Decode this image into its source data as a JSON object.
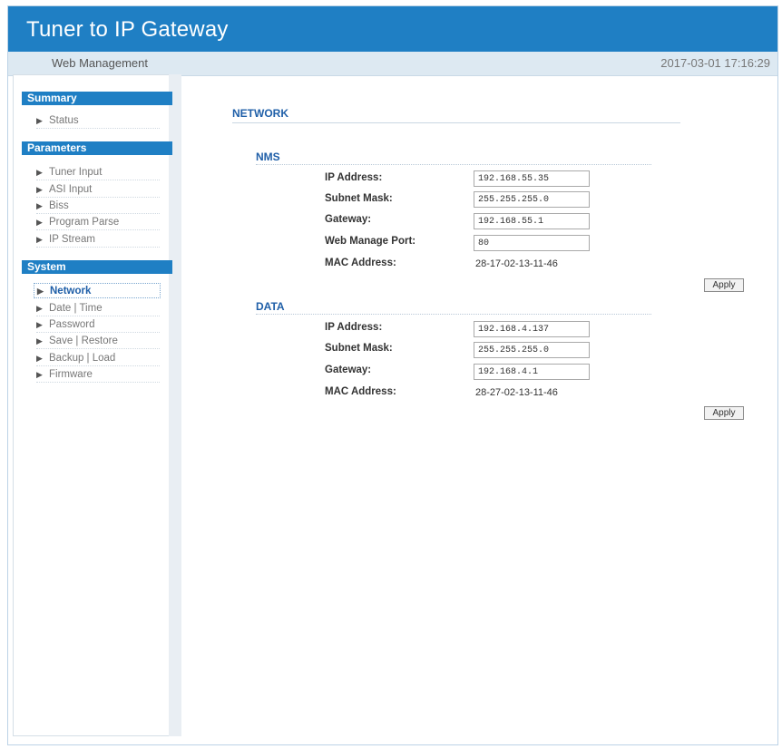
{
  "app": {
    "title": "Tuner to IP Gateway",
    "subtitle": "Web Management",
    "datetime": "2017-03-01 17:16:29"
  },
  "sidebar": {
    "sections": [
      {
        "title": "Summary",
        "items": [
          {
            "label": "Status"
          }
        ]
      },
      {
        "title": "Parameters",
        "items": [
          {
            "label": "Tuner Input"
          },
          {
            "label": "ASI Input"
          },
          {
            "label": "Biss"
          },
          {
            "label": "Program Parse"
          },
          {
            "label": "IP Stream"
          }
        ]
      },
      {
        "title": "System",
        "items": [
          {
            "label": "Network"
          },
          {
            "label": "Date | Time"
          },
          {
            "label": "Password"
          },
          {
            "label": "Save | Restore"
          },
          {
            "label": "Backup | Load"
          },
          {
            "label": "Firmware"
          }
        ]
      }
    ],
    "active_item": "Network"
  },
  "main": {
    "title": "NETWORK",
    "nms": {
      "title": "NMS",
      "ip_label": "IP Address:",
      "ip_value": "192.168.55.35",
      "mask_label": "Subnet Mask:",
      "mask_value": "255.255.255.0",
      "gateway_label": "Gateway:",
      "gateway_value": "192.168.55.1",
      "port_label": "Web Manage Port:",
      "port_value": "80",
      "mac_label": "MAC Address:",
      "mac_value": "28-17-02-13-11-46",
      "apply_label": "Apply"
    },
    "data": {
      "title": "DATA",
      "ip_label": "IP Address:",
      "ip_value": "192.168.4.137",
      "mask_label": "Subnet Mask:",
      "mask_value": "255.255.255.0",
      "gateway_label": "Gateway:",
      "gateway_value": "192.168.4.1",
      "mac_label": "MAC Address:",
      "mac_value": "28-27-02-13-11-46",
      "apply_label": "Apply"
    }
  },
  "colors": {
    "brand": "#1f7fc4",
    "subbar": "#dde9f2",
    "heading": "#1f5fa8"
  }
}
